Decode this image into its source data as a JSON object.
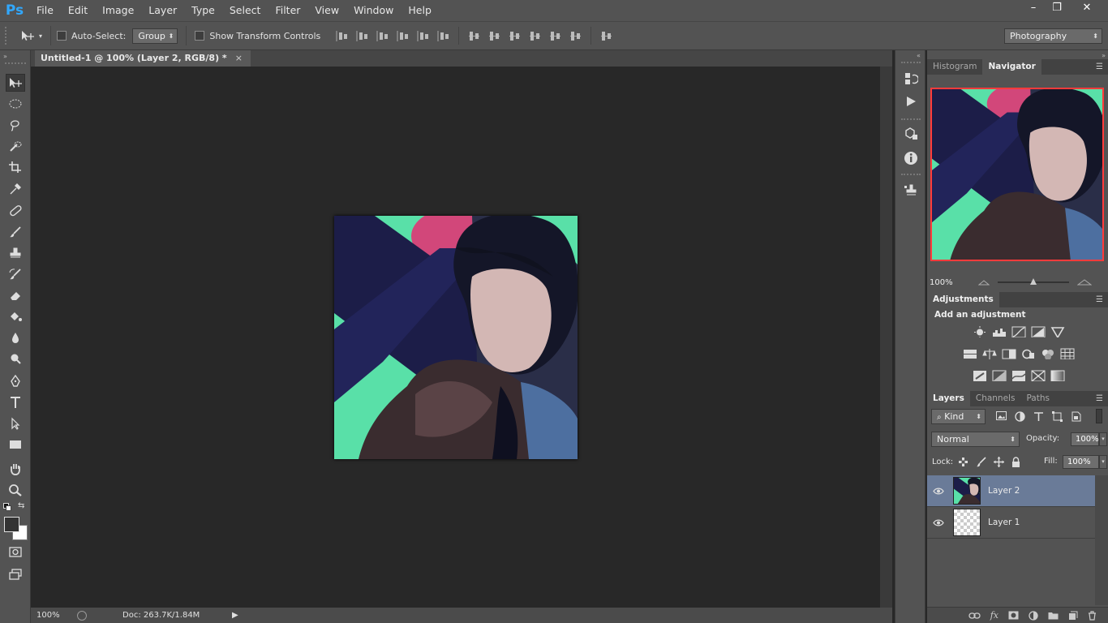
{
  "app": {
    "logo": "Ps",
    "menu": [
      "File",
      "Edit",
      "Image",
      "Layer",
      "Type",
      "Select",
      "Filter",
      "View",
      "Window",
      "Help"
    ]
  },
  "window_controls": {
    "minimize": "–",
    "restore": "❐",
    "close": "✕"
  },
  "options": {
    "auto_select_label": "Auto-Select:",
    "auto_select_mode": "Group",
    "transform_label": "Show Transform Controls",
    "workspace": "Photography"
  },
  "document": {
    "tab_title": "Untitled-1 @ 100% (Layer 2, RGB/8) *",
    "close_glyph": "×"
  },
  "status": {
    "zoom": "100%",
    "doc_size": "Doc: 263.7K/1.84M"
  },
  "navigator": {
    "tabs": [
      "Histogram",
      "Navigator"
    ],
    "active_tab": "Navigator",
    "zoom": "100%",
    "slider_fraction": 0.5
  },
  "adjustments": {
    "tab": "Adjustments",
    "heading": "Add an adjustment",
    "row1": [
      "brightness-contrast-icon",
      "levels-icon",
      "curves-icon",
      "exposure-icon",
      "vibrance-icon"
    ],
    "row2": [
      "hue-saturation-icon",
      "color-balance-icon",
      "black-white-icon",
      "photo-filter-icon",
      "channel-mixer-icon",
      "color-lookup-icon"
    ],
    "row3": [
      "invert-icon",
      "posterize-icon",
      "threshold-icon",
      "selective-color-icon",
      "gradient-map-icon"
    ]
  },
  "layers_panel": {
    "tabs": [
      "Layers",
      "Channels",
      "Paths"
    ],
    "active_tab": "Layers",
    "filter_kind": "Kind",
    "blend_mode": "Normal",
    "opacity_label": "Opacity:",
    "opacity": "100%",
    "lock_label": "Lock:",
    "fill_label": "Fill:",
    "fill": "100%",
    "layers": [
      {
        "name": "Layer 2",
        "selected": true,
        "visible": true
      },
      {
        "name": "Layer 1",
        "selected": false,
        "visible": true
      }
    ]
  },
  "colors": {
    "accent_blue": "#31a8ff",
    "selected_layer": "#6a7b98",
    "navigator_frame": "#ff3b3b"
  }
}
